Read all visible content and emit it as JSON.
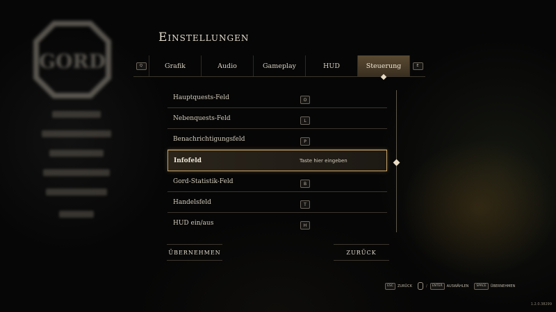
{
  "header": {
    "title": "Einstellungen"
  },
  "tabs": {
    "left_key": "Q",
    "right_key": "E",
    "items": [
      {
        "label": "Grafik"
      },
      {
        "label": "Audio"
      },
      {
        "label": "Gameplay"
      },
      {
        "label": "HUD"
      },
      {
        "label": "Steuerung"
      }
    ],
    "active": "Steuerung"
  },
  "rows": [
    {
      "label": "Hauptquests-Feld",
      "key": "O"
    },
    {
      "label": "Nebenquests-Feld",
      "key": "L"
    },
    {
      "label": "Benachrichtigungsfeld",
      "key": "P"
    },
    {
      "label": "Infofeld",
      "hint": "Taste hier eingeben"
    },
    {
      "label": "Gord-Statistik-Feld",
      "key": "B"
    },
    {
      "label": "Handelsfeld",
      "key": "T"
    },
    {
      "label": "HUD ein/aus",
      "key": "H"
    }
  ],
  "buttons": {
    "apply": "ÜBERNEHMEN",
    "back": "ZURÜCK"
  },
  "footer": {
    "esc_key": "ESC",
    "esc_label": "ZURÜCK",
    "enter_key": "ENTER",
    "enter_label": "AUSWÄHLEN",
    "space_key": "SPACE",
    "space_label": "ÜBERNEHMEN",
    "separator": "/"
  },
  "version": "1.2.0.38299",
  "colors": {
    "accent": "#c9a66b",
    "active_tab": "#5a4a33"
  }
}
